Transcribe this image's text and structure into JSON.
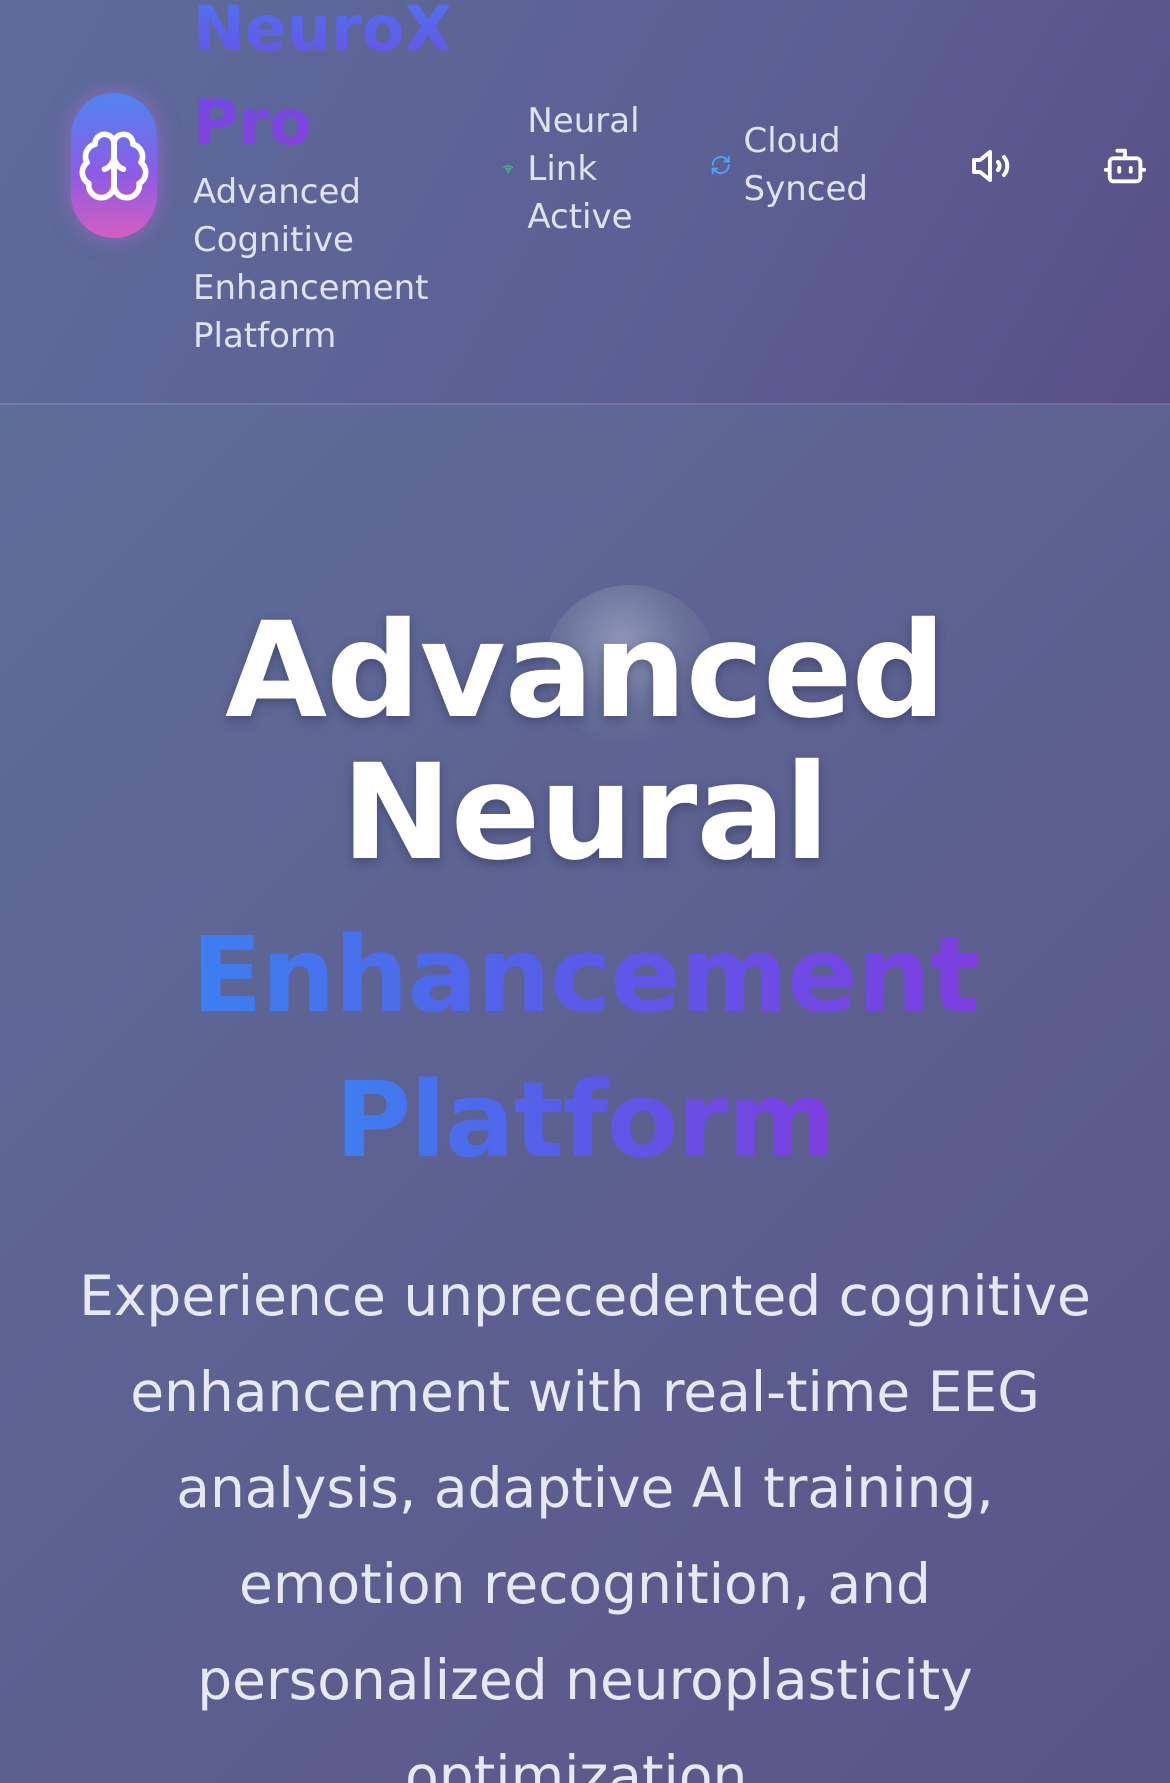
{
  "header": {
    "brand_name": "NeuroX Pro",
    "brand_subtitle": "Advanced Cognitive Enhancement Platform",
    "status_link": "Neural Link Active",
    "status_cloud": "Cloud Synced",
    "icons": {
      "logo": "brain-icon",
      "link": "wifi-icon",
      "cloud": "refresh-icon",
      "sound": "volume-icon",
      "bot": "bot-icon"
    }
  },
  "hero": {
    "title_line1": "Advanced",
    "title_line2": "Neural",
    "title_grad_line1": "Enhancement",
    "title_grad_line2": "Platform",
    "description": "Experience unprecedented cognitive enhancement with real-time EEG analysis, adaptive AI training, emotion recognition, and personalized neuroplasticity optimization."
  },
  "colors": {
    "accent_blue": "#3d7ff0",
    "accent_purple": "#7e3ee0",
    "status_green": "#3ed07a",
    "sync_blue": "#4aa3f5"
  }
}
